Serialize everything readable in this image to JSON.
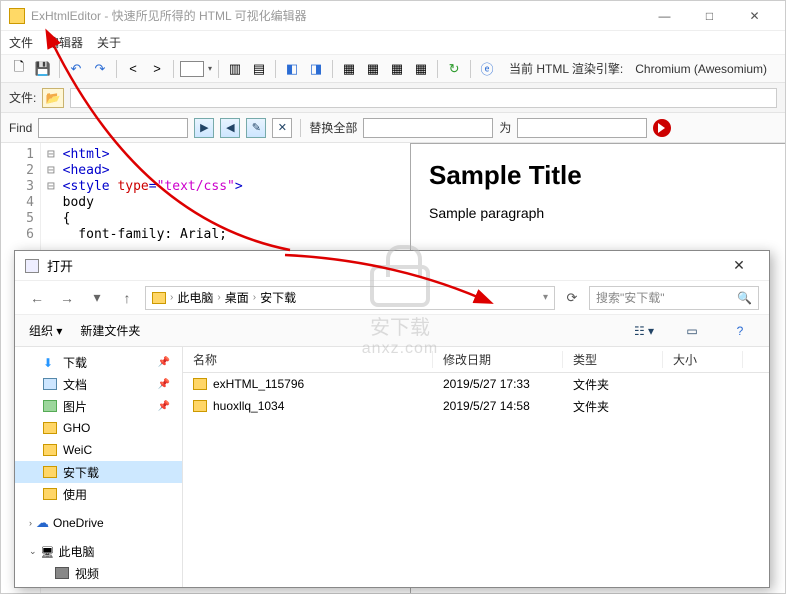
{
  "window": {
    "title": "ExHtmlEditor - 快速所见所得的 HTML 可视化编辑器",
    "min": "—",
    "max": "□",
    "close": "✕"
  },
  "menu": {
    "file": "文件",
    "editor": "编辑器",
    "about": "关于"
  },
  "toolbar": {
    "render_label": "当前 HTML 渲染引擎:",
    "render_engine": "Chromium (Awesomium)"
  },
  "filebar": {
    "label": "文件:"
  },
  "findbar": {
    "find_label": "Find",
    "replace_label": "替换全部",
    "to_label": "为"
  },
  "code": {
    "lines": [
      "1",
      "2",
      "3",
      "4",
      "5",
      "6"
    ],
    "l1_open": "<html>",
    "l2_open": "<head>",
    "l3_a": "<style",
    "l3_b": " type",
    "l3_c": "=",
    "l3_d": "\"text/css\"",
    "l3_e": ">",
    "l4": "  body",
    "l5": "  {",
    "l6": "    font-family: Arial;"
  },
  "preview": {
    "title": "Sample Title",
    "para": "Sample paragraph"
  },
  "dialog": {
    "title": "打开",
    "breadcrumb": [
      "此电脑",
      "桌面",
      "安下载"
    ],
    "search_placeholder": "搜索\"安下载\"",
    "organize": "组织",
    "new_folder": "新建文件夹",
    "cols": {
      "name": "名称",
      "date": "修改日期",
      "type": "类型",
      "size": "大小"
    },
    "rows": [
      {
        "name": "exHTML_115796",
        "date": "2019/5/27 17:33",
        "type": "文件夹"
      },
      {
        "name": "huoxllq_1034",
        "date": "2019/5/27 14:58",
        "type": "文件夹"
      }
    ],
    "sidebar": {
      "downloads": "下载",
      "documents": "文档",
      "pictures": "图片",
      "gho": "GHO",
      "weic": "WeiC",
      "anxz": "安下载",
      "shiyong": "使用",
      "onedrive": "OneDrive",
      "thispc": "此电脑",
      "video": "视频"
    }
  },
  "watermark": {
    "cn": "安下载",
    "domain": "anxz.com"
  }
}
